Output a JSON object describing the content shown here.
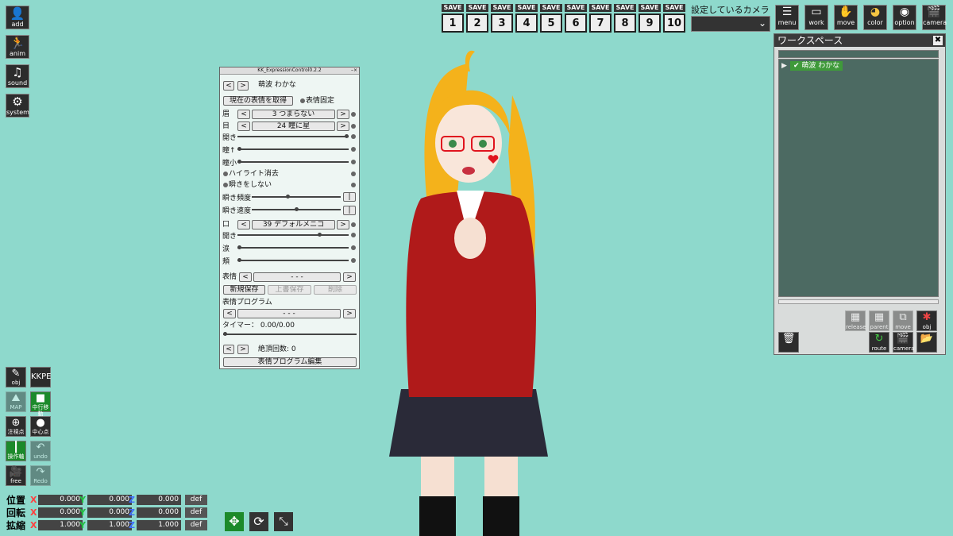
{
  "left_toolbar": [
    {
      "label": "add",
      "icon": "person-icon"
    },
    {
      "label": "anim",
      "icon": "running-icon"
    },
    {
      "label": "sound",
      "icon": "music-note-icon"
    },
    {
      "label": "system",
      "icon": "gears-icon"
    }
  ],
  "save_slots": {
    "caption": "SAVE",
    "numbers": [
      "1",
      "2",
      "3",
      "4",
      "5",
      "6",
      "7",
      "8",
      "9",
      "10"
    ]
  },
  "camera_select": {
    "label": "設定しているカメラ",
    "value": ""
  },
  "right_toolbar": [
    {
      "label": "menu",
      "icon": "list-icon"
    },
    {
      "label": "work",
      "icon": "folder-icon"
    },
    {
      "label": "move",
      "icon": "hand-icon"
    },
    {
      "label": "color",
      "icon": "palette-icon"
    },
    {
      "label": "option",
      "icon": "eye-icon"
    },
    {
      "label": "camera",
      "icon": "clapper-icon"
    }
  ],
  "expression": {
    "title": "KK_ExpressionControl0.2.2",
    "character": "萌波 わかな",
    "get_expression": "現在の表情を取得",
    "fix_expression": "表情固定",
    "brow": {
      "label": "眉",
      "value": "3 つまらない"
    },
    "eye": {
      "label": "目",
      "value": "24 瞳に星"
    },
    "open_eye": {
      "label": "開き",
      "level": 1.0
    },
    "pupil": {
      "label": "瞳↑",
      "level": 0.0
    },
    "pupil_small": {
      "label": "瞳小",
      "level": 0.0
    },
    "highlight_off": "ハイライト消去",
    "no_blink": "瞬きをしない",
    "blink_freq": {
      "label": "瞬き頻度",
      "level": 0.4
    },
    "blink_speed": {
      "label": "瞬き速度",
      "level": 0.5
    },
    "mouth": {
      "label": "口",
      "value": "39 デフォルメニコ"
    },
    "mouth_open": {
      "label": "開き",
      "level": 0.75
    },
    "tears": {
      "label": "涙",
      "level": 0.0
    },
    "cheek": {
      "label": "頬",
      "level": 0.0
    },
    "preset": {
      "label": "表情",
      "value": "- - -"
    },
    "new_save": "新規保存",
    "overwrite_save": "上書保存",
    "delete": "削除",
    "program_label": "表情プログラム",
    "program_value": "- - -",
    "timer": "タイマー： 0.00/0.00",
    "climax": "絶頂回数: 0",
    "edit_program": "表情プログラム編集",
    "prev": "<",
    "next": ">",
    "slider_end": "|"
  },
  "workspace": {
    "title": "ワークスペース",
    "close": "✖",
    "items": [
      {
        "name": "萌波 わかな",
        "checked": "✔"
      }
    ],
    "buttons": [
      {
        "label": "delete",
        "icon": "trash-icon"
      },
      {
        "label": "route",
        "icon": "route-icon"
      },
      {
        "label": "camera",
        "icon": "clapper-icon"
      },
      {
        "label": "folder",
        "icon": "folder-open-icon"
      }
    ],
    "top_buttons": [
      "release",
      "parent",
      "move copy",
      "obj copy"
    ]
  },
  "bottom_tools": [
    [
      "obj",
      "KKPE"
    ],
    [
      "MAP",
      "中行移動"
    ],
    [
      "注視点",
      "中心点"
    ],
    [
      "操作軸",
      "undo"
    ],
    [
      "free",
      "Redo"
    ]
  ],
  "coords": {
    "axes": [
      "X",
      "Y",
      "Z"
    ],
    "def": "def",
    "rows": [
      {
        "label": "位置",
        "x": "0.000",
        "y": "0.000",
        "z": "0.000"
      },
      {
        "label": "回転",
        "x": "0.000",
        "y": "0.000",
        "z": "0.000"
      },
      {
        "label": "拡縮",
        "x": "1.000",
        "y": "1.000",
        "z": "1.000"
      }
    ]
  },
  "colors": {
    "background": "#8ed9cc",
    "panel": "#eef6f3",
    "green": "#1c8a2a",
    "x_axis": "#ff4040",
    "y_axis": "#20c040",
    "z_axis": "#4070ff"
  }
}
